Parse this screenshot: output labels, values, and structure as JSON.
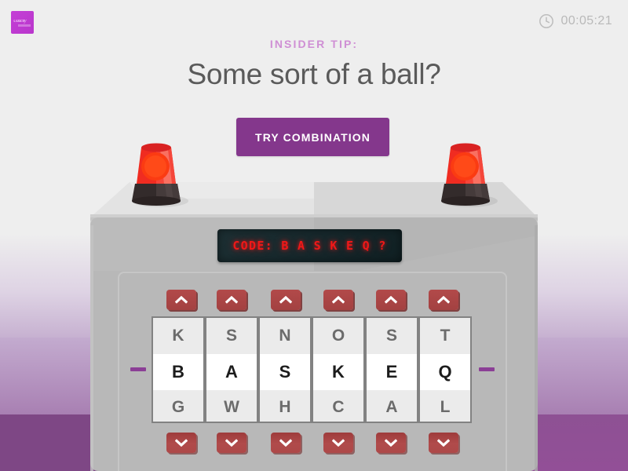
{
  "header": {
    "logo_text": "Udacity",
    "timer": {
      "icon": "clock-icon",
      "value": "00:05:21"
    }
  },
  "tip": {
    "label": "INSIDER TIP:",
    "text": "Some sort of a ball?"
  },
  "actions": {
    "try_combination_label": "TRY COMBINATION"
  },
  "code_display": {
    "prefix": "CODE:",
    "value": "B A S K E Q ?",
    "full": "CODE: B A S K E Q ?",
    "unset_char": "?"
  },
  "reels": [
    {
      "up_label": "up",
      "down_label": "down",
      "above": "K",
      "selected": "B",
      "below": "G"
    },
    {
      "up_label": "up",
      "down_label": "down",
      "above": "S",
      "selected": "A",
      "below": "W"
    },
    {
      "up_label": "up",
      "down_label": "down",
      "above": "N",
      "selected": "S",
      "below": "H"
    },
    {
      "up_label": "up",
      "down_label": "down",
      "above": "O",
      "selected": "K",
      "below": "C"
    },
    {
      "up_label": "up",
      "down_label": "down",
      "above": "S",
      "selected": "E",
      "below": "A"
    },
    {
      "up_label": "up",
      "down_label": "down",
      "above": "T",
      "selected": "Q",
      "below": "L"
    }
  ],
  "sirens": [
    {
      "name": "alarm-light-left",
      "state": "on"
    },
    {
      "name": "alarm-light-right",
      "state": "on"
    }
  ],
  "colors": {
    "accent_purple": "#84378c",
    "tip_label": "#cf8fd4",
    "led_red": "#ef1818",
    "button_red": "#a34141",
    "machine_body": "#b8b8b8",
    "floor": "#924f97",
    "brand": "#c43fd6"
  }
}
